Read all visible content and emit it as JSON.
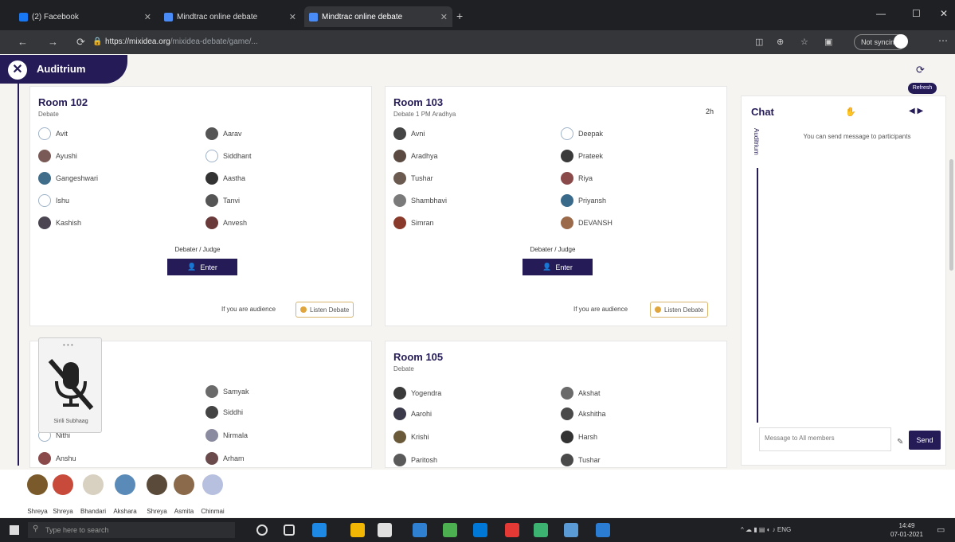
{
  "browser": {
    "tabs": [
      {
        "label": "(2) Facebook",
        "color": "#1877f2"
      },
      {
        "label": "Mindtrac online debate",
        "color": "#4a8cf7"
      },
      {
        "label": "Mindtrac online debate",
        "color": "#4a8cf7"
      }
    ],
    "url_host": "https://mixidea.org",
    "url_rest": "/mixidea-debate/game/...",
    "not_syncing": "Not syncing"
  },
  "app": {
    "title": "Auditrium",
    "refresh_label": "Refresh"
  },
  "rooms": [
    {
      "title": "Room 102",
      "subtitle": "Debate",
      "badge": "",
      "participants": [
        {
          "name": "Avit",
          "blank": true
        },
        {
          "name": "Aarav",
          "color": "#555"
        },
        {
          "name": "Ayushi",
          "color": "#7a5a56"
        },
        {
          "name": "Siddhant",
          "blank": true
        },
        {
          "name": "Gangeshwari",
          "color": "#3f6d8a"
        },
        {
          "name": "Aastha",
          "color": "#333"
        },
        {
          "name": "Ishu",
          "blank": true
        },
        {
          "name": "Tanvi",
          "color": "#555"
        },
        {
          "name": "Kashish",
          "color": "#4a4550"
        },
        {
          "name": "Anvesh",
          "color": "#6a3a3a"
        }
      ],
      "judge_label": "Debater / Judge",
      "enter_label": "Enter",
      "audience_note": "If you are audience",
      "listen_label": "Listen Debate"
    },
    {
      "title": "Room 103",
      "subtitle": "Debate 1 PM Aradhya",
      "badge": "2h",
      "participants": [
        {
          "name": "Avni",
          "color": "#444"
        },
        {
          "name": "Deepak",
          "blank": true
        },
        {
          "name": "Aradhya",
          "color": "#5a4a42"
        },
        {
          "name": "Prateek",
          "color": "#3a3a3a"
        },
        {
          "name": "Tushar",
          "color": "#6a5a50"
        },
        {
          "name": "Riya",
          "color": "#8a4a4a"
        },
        {
          "name": "Shambhavi",
          "color": "#7a7a7a"
        },
        {
          "name": "Priyansh",
          "color": "#3a6a8a"
        },
        {
          "name": "Simran",
          "color": "#8a3a2a"
        },
        {
          "name": "DEVANSH",
          "color": "#9a6a4a"
        }
      ],
      "judge_label": "Debater / Judge",
      "enter_label": "Enter",
      "audience_note": "If you are audience",
      "listen_label": "Listen Debate"
    },
    {
      "title": "",
      "subtitle": "",
      "badge": "",
      "participants": [
        {
          "name": "",
          "blank": true
        },
        {
          "name": "Samyak",
          "color": "#6a6a6a"
        },
        {
          "name": "",
          "blank": true
        },
        {
          "name": "Siddhi",
          "color": "#444"
        },
        {
          "name": "Nithi",
          "blank": true
        },
        {
          "name": "Nirmala",
          "color": "#8a8aa0"
        },
        {
          "name": "Anshu",
          "color": "#8a4a4a"
        },
        {
          "name": "Arham",
          "color": "#6a4a4a"
        }
      ]
    },
    {
      "title": "Room 105",
      "subtitle": "Debate",
      "badge": "",
      "participants": [
        {
          "name": "Yogendra",
          "color": "#3a3a3a"
        },
        {
          "name": "Akshat",
          "color": "#6a6a6a"
        },
        {
          "name": "Aarohi",
          "color": "#3a3a4a"
        },
        {
          "name": "Akshitha",
          "color": "#4a4a4a"
        },
        {
          "name": "Krishi",
          "color": "#6a5a3a"
        },
        {
          "name": "Harsh",
          "color": "#333"
        },
        {
          "name": "Paritosh",
          "color": "#5a5a5a"
        },
        {
          "name": "Tushar",
          "color": "#4a4a4a"
        }
      ]
    }
  ],
  "video_popover": {
    "name": "Sirili Subhaag",
    "dots": "• • •"
  },
  "chat": {
    "title": "Chat",
    "tab_label": "Auditrium",
    "info": "You can send message to participants",
    "input_placeholder": "Message to All members",
    "send_label": "Send"
  },
  "audience": [
    {
      "name": "Shreya",
      "color": "#7a5a2a"
    },
    {
      "name": "Shreya",
      "color": "#c84a3a"
    },
    {
      "name": "Bhandari",
      "color": "#d8d0c0"
    },
    {
      "name": "Akshara",
      "color": "#5a8ab8"
    },
    {
      "name": "Shreya",
      "color": "#5a4a3a"
    },
    {
      "name": "Asmita",
      "color": "#8a6a4a"
    },
    {
      "name": "Chinmai",
      "color": "#b8c0e0"
    }
  ],
  "taskbar": {
    "search_placeholder": "Type here to search",
    "clock_time": "14:49",
    "clock_date": "07-01-2021"
  }
}
